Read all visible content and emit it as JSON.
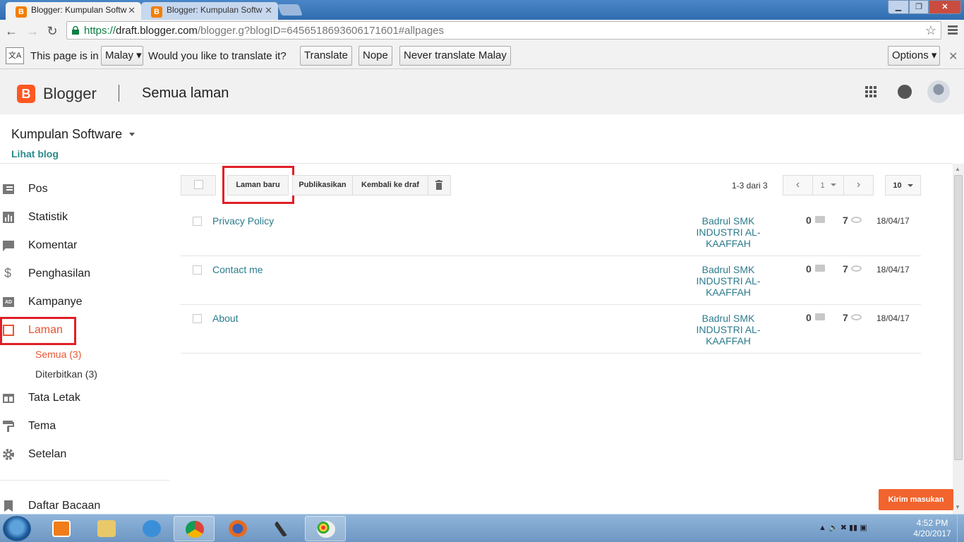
{
  "browser": {
    "tabs": [
      {
        "label": "Blogger: Kumpulan Softw"
      },
      {
        "label": "Blogger: Kumpulan Softw"
      }
    ],
    "url": {
      "proto": "https://",
      "host": "draft.blogger.com",
      "path": "/blogger.g?blogID=6456518693606171601#allpages"
    }
  },
  "translate_bar": {
    "prefix": "This page is in",
    "language": "Malay",
    "question": "Would you like to translate it?",
    "translate": "Translate",
    "nope": "Nope",
    "never": "Never translate Malay",
    "options": "Options"
  },
  "header": {
    "brand": "Blogger",
    "title": "Semua laman"
  },
  "blog": {
    "name": "Kumpulan Software",
    "view_link": "Lihat blog"
  },
  "sidebar": {
    "items": [
      {
        "label": "Pos",
        "icon": "posts-icon"
      },
      {
        "label": "Statistik",
        "icon": "stats-icon"
      },
      {
        "label": "Komentar",
        "icon": "comment-icon"
      },
      {
        "label": "Penghasilan",
        "icon": "dollar-icon"
      },
      {
        "label": "Kampanye",
        "icon": "ad-icon"
      },
      {
        "label": "Laman",
        "icon": "page-icon"
      },
      {
        "label": "Tata Letak",
        "icon": "layout-icon"
      },
      {
        "label": "Tema",
        "icon": "paint-roller-icon"
      },
      {
        "label": "Setelan",
        "icon": "gear-icon"
      },
      {
        "label": "Daftar Bacaan",
        "icon": "bookmark-icon"
      }
    ],
    "sub_items": [
      {
        "label": "Semua (3)"
      },
      {
        "label": "Diterbitkan (3)"
      }
    ]
  },
  "actions": {
    "new_page": "Laman baru",
    "publish": "Publikasikan",
    "revert": "Kembali ke draf"
  },
  "pagination": {
    "range": "1-3 dari 3",
    "page": "1",
    "per_page": "10"
  },
  "pages": [
    {
      "title": "Privacy Policy",
      "author": "Badrul SMK INDUSTRI AL-KAAFFAH",
      "comments": "0",
      "views": "7",
      "date": "18/04/17"
    },
    {
      "title": "Contact me",
      "author": "Badrul SMK INDUSTRI AL-KAAFFAH",
      "comments": "0",
      "views": "7",
      "date": "18/04/17"
    },
    {
      "title": "About",
      "author": "Badrul SMK INDUSTRI AL-KAAFFAH",
      "comments": "0",
      "views": "7",
      "date": "18/04/17"
    }
  ],
  "feedback": "Kirim masukan",
  "taskbar": {
    "time": "4:52 PM",
    "date": "4/20/2017"
  },
  "colors": {
    "accent": "#e8542f",
    "link": "#2b7b8c",
    "highlight_box": "#e01f26",
    "blogger_orange": "#ff5722"
  }
}
